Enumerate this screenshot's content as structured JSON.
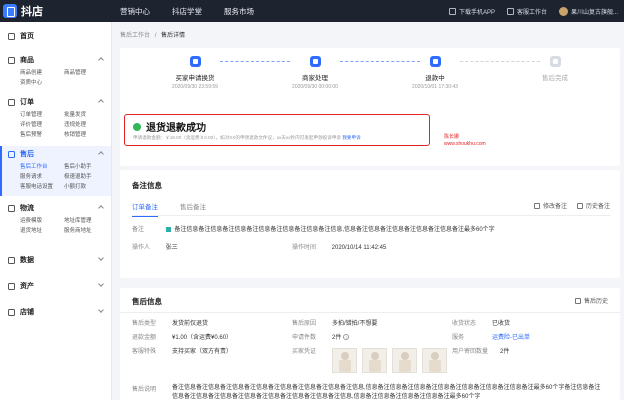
{
  "topbar": {
    "logo_text": "抖店",
    "nav": [
      "营销中心",
      "抖店学堂",
      "服务市场"
    ],
    "download": "下载手机APP",
    "service_desk": "客服工作台",
    "shop_name": "果川山复古旗舰..."
  },
  "sidebar": {
    "home": "首页",
    "sections": [
      {
        "title": "商品",
        "items": [
          "商品创建",
          "商品管理",
          "资质中心"
        ]
      },
      {
        "title": "订单",
        "items": [
          "订单管理",
          "批量发货",
          "评价管理",
          "违规处理",
          "售后预警",
          "核销管理"
        ]
      },
      {
        "title": "售后",
        "items": [
          "售后工作台",
          "售后小助手",
          "服务请求",
          "极速退助手",
          "客服电话设置",
          "小额打款"
        ]
      },
      {
        "title": "物流",
        "items": [
          "运费模版",
          "地址库管理",
          "退货地址",
          "服务商地址"
        ]
      }
    ],
    "tail": [
      "数据",
      "资产",
      "店铺"
    ]
  },
  "breadcrumb": {
    "parent": "售后工作台",
    "separator": "/",
    "current": "售后详情"
  },
  "steps": [
    {
      "title": "买家申请换货",
      "time": "2020/09/30 23:59:59"
    },
    {
      "title": "商家处理",
      "time": "2020/09/30 00:00:00"
    },
    {
      "title": "退款中",
      "time": "2020/10/01 17:30:43"
    },
    {
      "title": "售后完成",
      "time": ""
    }
  ],
  "status": {
    "title": "退货退款成功",
    "note": "申请退款金额：￥19.00（含运费￥0.00），如对XX的申领退款文件议，xx天xx秒内可发起申领投诉申诉",
    "link": "我要申诉",
    "watermark_line1": "陈长娜",
    "watermark_line2": "www.shoukhu.com"
  },
  "notes": {
    "title": "备注信息",
    "tabs": [
      "订单备注",
      "售后备注"
    ],
    "actions": [
      "修改备注",
      "历史备注"
    ],
    "remark_label": "备注",
    "remark_value": "备注信息备注信息备注信息备注信息备注信息备注信息备注信息,信息备注信息备注信息备注信息备注信息备注最多60个字",
    "operator_label": "操作人",
    "operator_value": "张三",
    "time_label": "操作时间",
    "time_value": "2020/10/14  11:42:45"
  },
  "after_sale": {
    "title": "售后信息",
    "history": "售后历史",
    "fields": {
      "type_label": "售后类型",
      "type_value": "发货前仅退货",
      "reason_label": "售后原因",
      "reason_value": "多拍/错拍/不想要",
      "receive_label": "收货状态",
      "receive_value": "已收货",
      "amount_label": "退款金额",
      "amount_value": "¥1.00（含运费¥0.60）",
      "count_label": "申请件数",
      "count_value": "2件",
      "service_label": "服务",
      "service_value": "运费险-已出单",
      "guarantee_label": "客服特殊",
      "guarantee_value": "支持买家（双方有责）",
      "evidence_label": "买家凭证",
      "sent_label": "用户寄回数量",
      "sent_value": "2件",
      "desc_label": "售后说明",
      "desc_value": "备注信息备注信息备注信息备注信息备注信息备注信息备注信息备注信息,信息备注信息备注信息备注信息备注信息备注信息备注信息备注最多60个字备注信息备注信息备注信息备注信息备注信息备注信息备注信息备注信息备注信息,信息备注信息备注信息备注信息备注最多60个字"
    }
  },
  "colors": {
    "accent": "#2f6bff",
    "success": "#31b757",
    "alert": "#e02424",
    "topbar": "#1e2330"
  }
}
